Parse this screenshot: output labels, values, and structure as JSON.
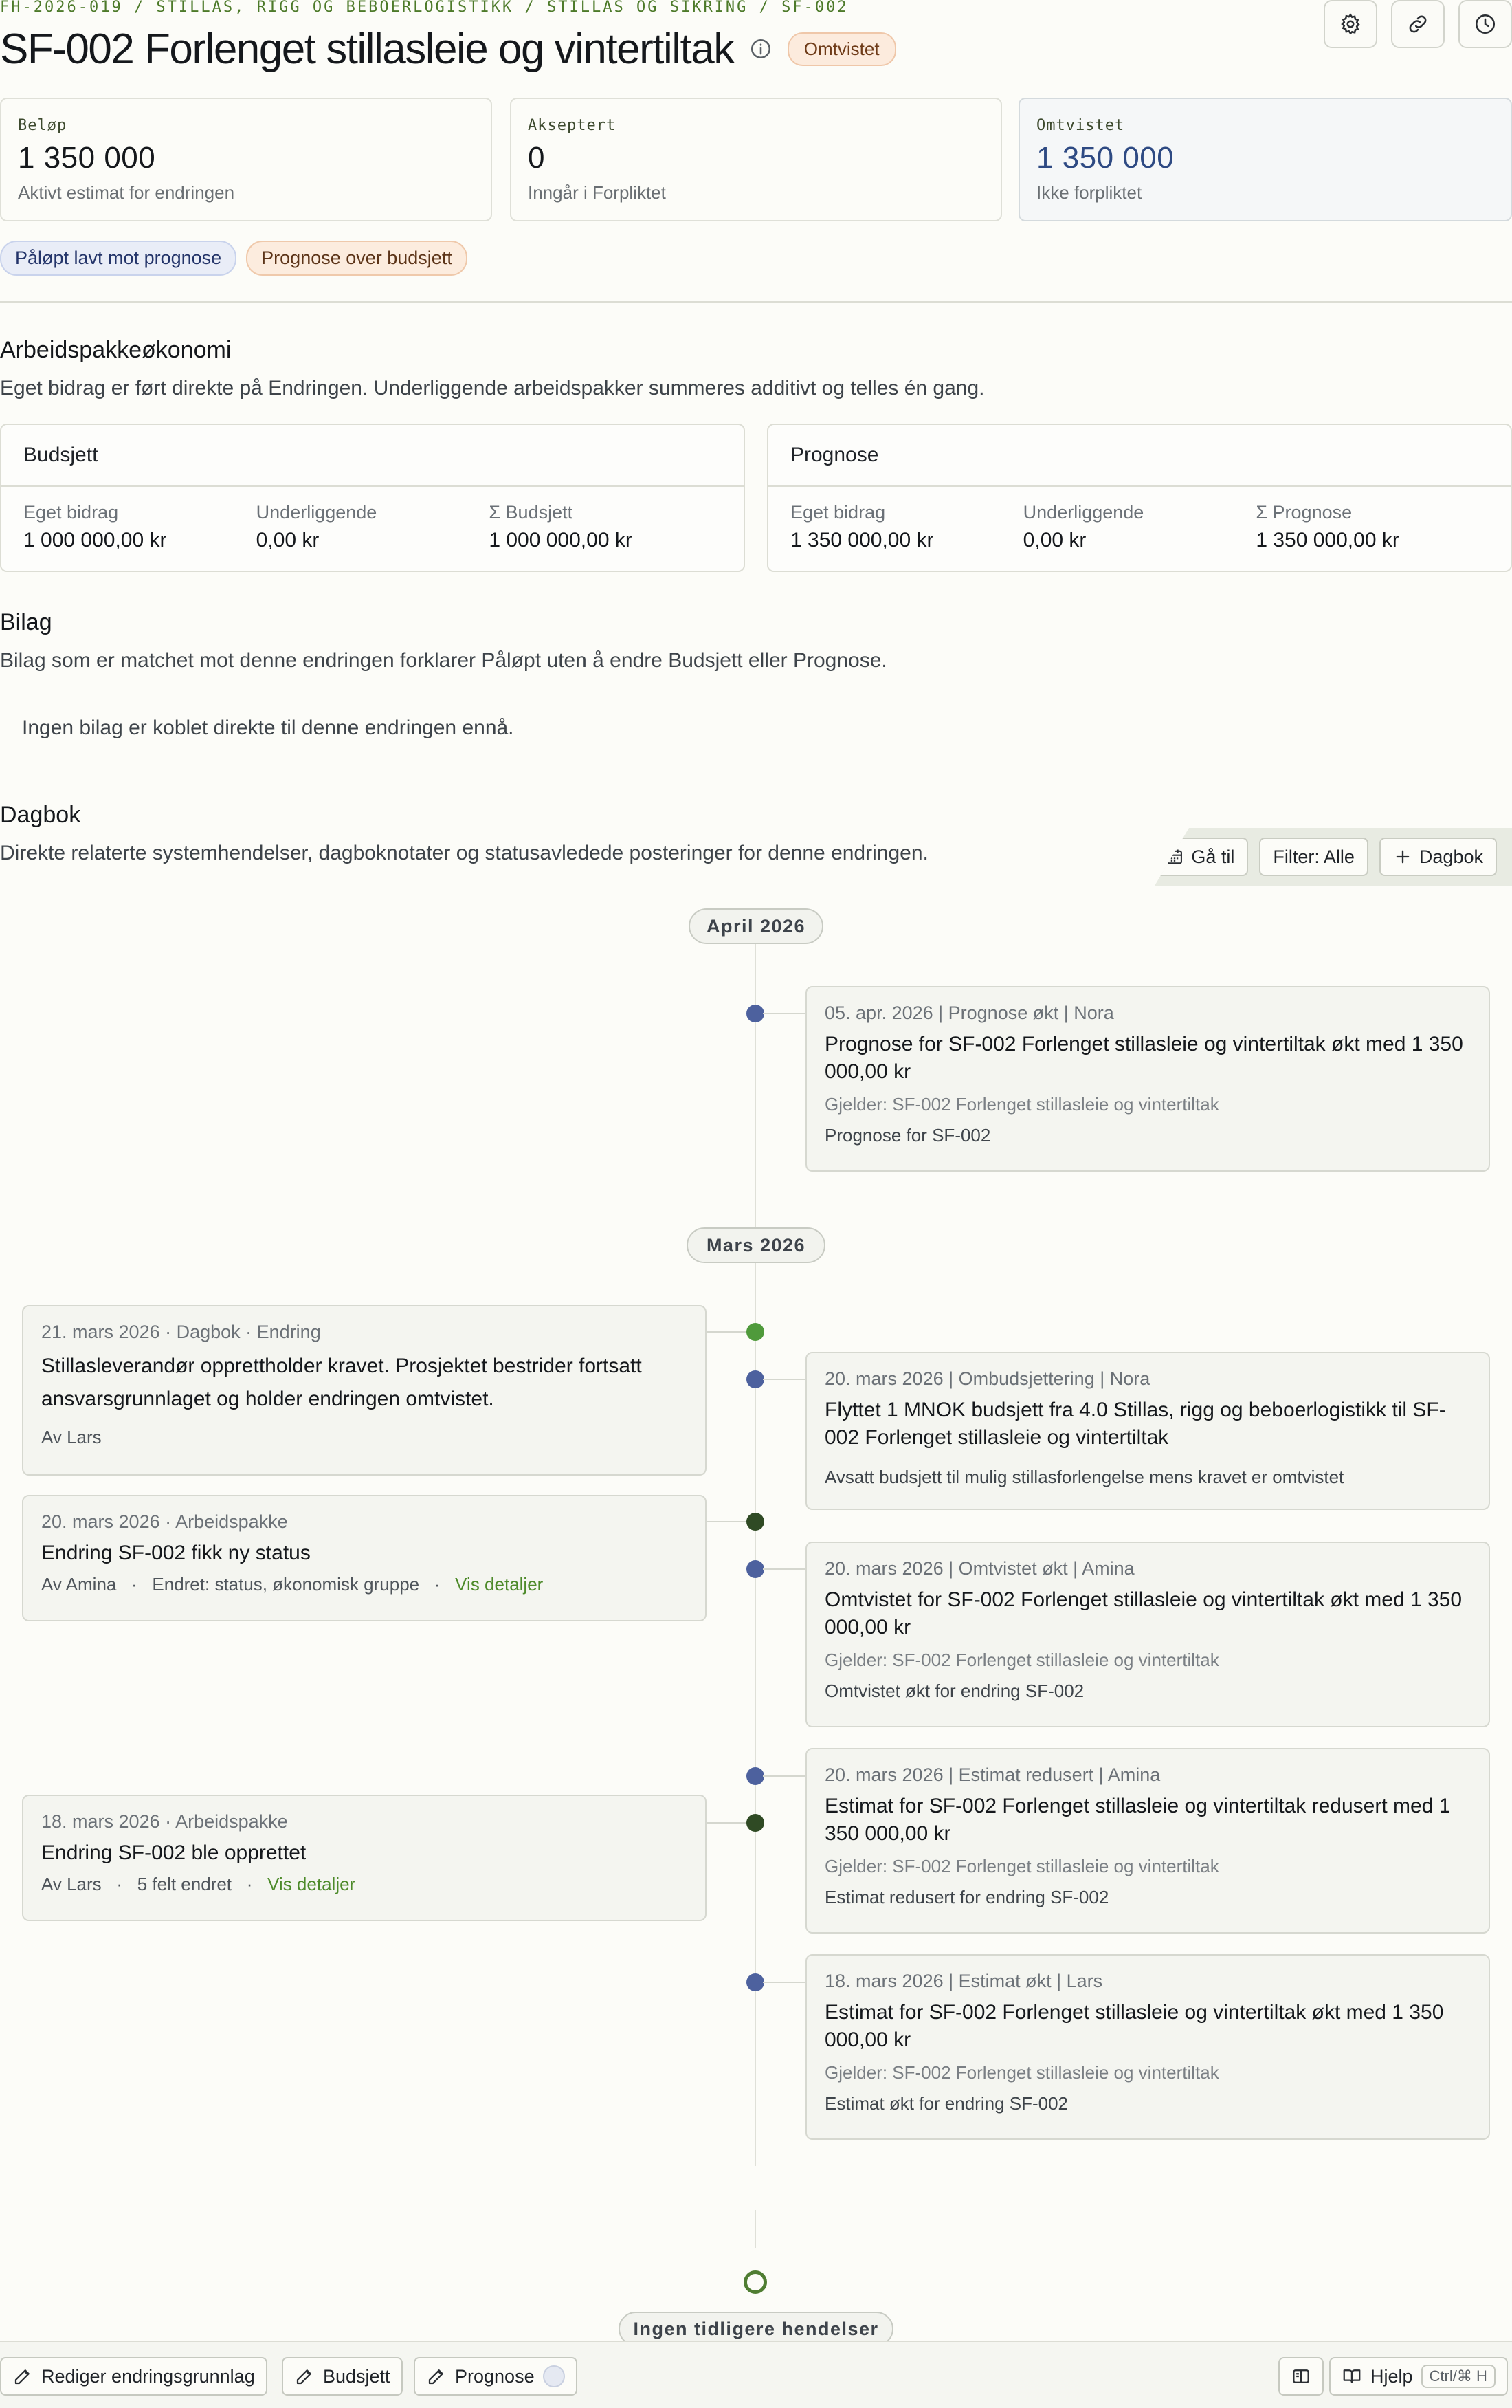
{
  "breadcrumb": "FH-2026-019 / STILLAS, RIGG OG BEBOERLOGISTIKK / STILLAS OG SIKRING / SF-002",
  "header": {
    "title": "SF-002 Forlenget stillasleie og vintertiltak",
    "status": "Omtvistet",
    "icons": [
      "gear-icon",
      "link-icon",
      "clock-icon"
    ]
  },
  "kpis": [
    {
      "label": "Beløp",
      "value": "1 350 000",
      "sub": "Aktivt estimat for endringen"
    },
    {
      "label": "Akseptert",
      "value": "0",
      "sub": "Inngår i Forpliktet"
    },
    {
      "label": "Omtvistet",
      "value": "1 350 000",
      "sub": "Ikke forpliktet"
    }
  ],
  "flags": [
    "Påløpt lavt mot prognose",
    "Prognose over budsjett"
  ],
  "economy": {
    "title": "Arbeidspakkeøkonomi",
    "description": "Eget bidrag er ført direkte på Endringen. Underliggende arbeidspakker summeres additivt og telles én gang.",
    "budget": {
      "title": "Budsjett",
      "cols": [
        {
          "label": "Eget bidrag",
          "value": "1 000 000,00 kr"
        },
        {
          "label": "Underliggende",
          "value": "0,00 kr"
        },
        {
          "label": "Σ Budsjett",
          "value": "1 000 000,00 kr"
        }
      ]
    },
    "forecast": {
      "title": "Prognose",
      "cols": [
        {
          "label": "Eget bidrag",
          "value": "1 350 000,00 kr"
        },
        {
          "label": "Underliggende",
          "value": "0,00 kr"
        },
        {
          "label": "Σ Prognose",
          "value": "1 350 000,00 kr"
        }
      ]
    }
  },
  "attachments": {
    "title": "Bilag",
    "description": "Bilag som er matchet mot denne endringen forklarer Påløpt uten å endre Budsjett eller Prognose.",
    "empty": "Ingen bilag er koblet direkte til denne endringen ennå."
  },
  "journal": {
    "title": "Dagbok",
    "description": "Direkte relaterte systemhendelser, dagboknotater og statusavledede posteringer for denne endringen.",
    "goto_label": "Gå til",
    "filter_label": "Filter: Alle",
    "add_label": "Dagbok",
    "months": [
      "April 2026",
      "Mars 2026"
    ],
    "end_label": "Ingen tidligere hendelser",
    "right_events": [
      {
        "meta": "05. apr. 2026  |  Prognose økt  |  Nora",
        "title": "Prognose for SF-002 Forlenget stillasleie og vintertiltak økt med 1 350 000,00 kr",
        "sub": "Gjelder: SF-002 Forlenget stillasleie og vintertiltak",
        "note": "Prognose for SF-002"
      },
      {
        "meta": "20. mars 2026  |  Ombudsjettering  |  Nora",
        "title": "Flyttet 1 MNOK budsjett fra 4.0 Stillas, rigg og beboerlogistikk til SF-002 Forlenget stillasleie og vintertiltak",
        "sub": "",
        "note": "Avsatt budsjett til mulig stillasforlengelse mens kravet er omtvistet"
      },
      {
        "meta": "20. mars 2026  |  Omtvistet økt  |  Amina",
        "title": "Omtvistet for SF-002 Forlenget stillasleie og vintertiltak økt med 1 350 000,00 kr",
        "sub": "Gjelder: SF-002 Forlenget stillasleie og vintertiltak",
        "note": "Omtvistet økt for endring SF-002"
      },
      {
        "meta": "20. mars 2026  |  Estimat redusert  |  Amina",
        "title": "Estimat for SF-002 Forlenget stillasleie og vintertiltak redusert med 1 350 000,00 kr",
        "sub": "Gjelder: SF-002 Forlenget stillasleie og vintertiltak",
        "note": "Estimat redusert for endring SF-002"
      },
      {
        "meta": "18. mars 2026  |  Estimat økt  |  Lars",
        "title": "Estimat for SF-002 Forlenget stillasleie og vintertiltak økt med 1 350 000,00 kr",
        "sub": "Gjelder: SF-002 Forlenget stillasleie og vintertiltak",
        "note": "Estimat økt for endring SF-002"
      }
    ],
    "left_events": [
      {
        "meta": "21. mars 2026  ·  Dagbok  ·  Endring",
        "title": "Stillasleverandør opprettholder kravet. Prosjektet bestrider fortsatt ansvarsgrunnlaget og holder endringen omtvistet.",
        "by": "Av Lars",
        "extra": "",
        "link": ""
      },
      {
        "meta": "20. mars 2026  ·  Arbeidspakke",
        "title": "Endring SF-002 fikk ny status",
        "by": "Av Amina",
        "extra": "Endret: status, økonomisk gruppe",
        "link": "Vis detaljer"
      },
      {
        "meta": "18. mars 2026  ·  Arbeidspakke",
        "title": "Endring SF-002 ble opprettet",
        "by": "Av Lars",
        "extra": "5 felt endret",
        "link": "Vis detaljer"
      }
    ]
  },
  "bottom_bar": {
    "edit_label": "Rediger endringsgrunnlag",
    "budget_label": "Budsjett",
    "forecast_label": "Prognose",
    "help_label": "Hjelp",
    "shortcut": "Ctrl/⌘ H"
  },
  "colors": {
    "accent_green": "#4d7a2a",
    "timeline_blue": "#4d619e",
    "disputed_value": "#2e4a83"
  }
}
